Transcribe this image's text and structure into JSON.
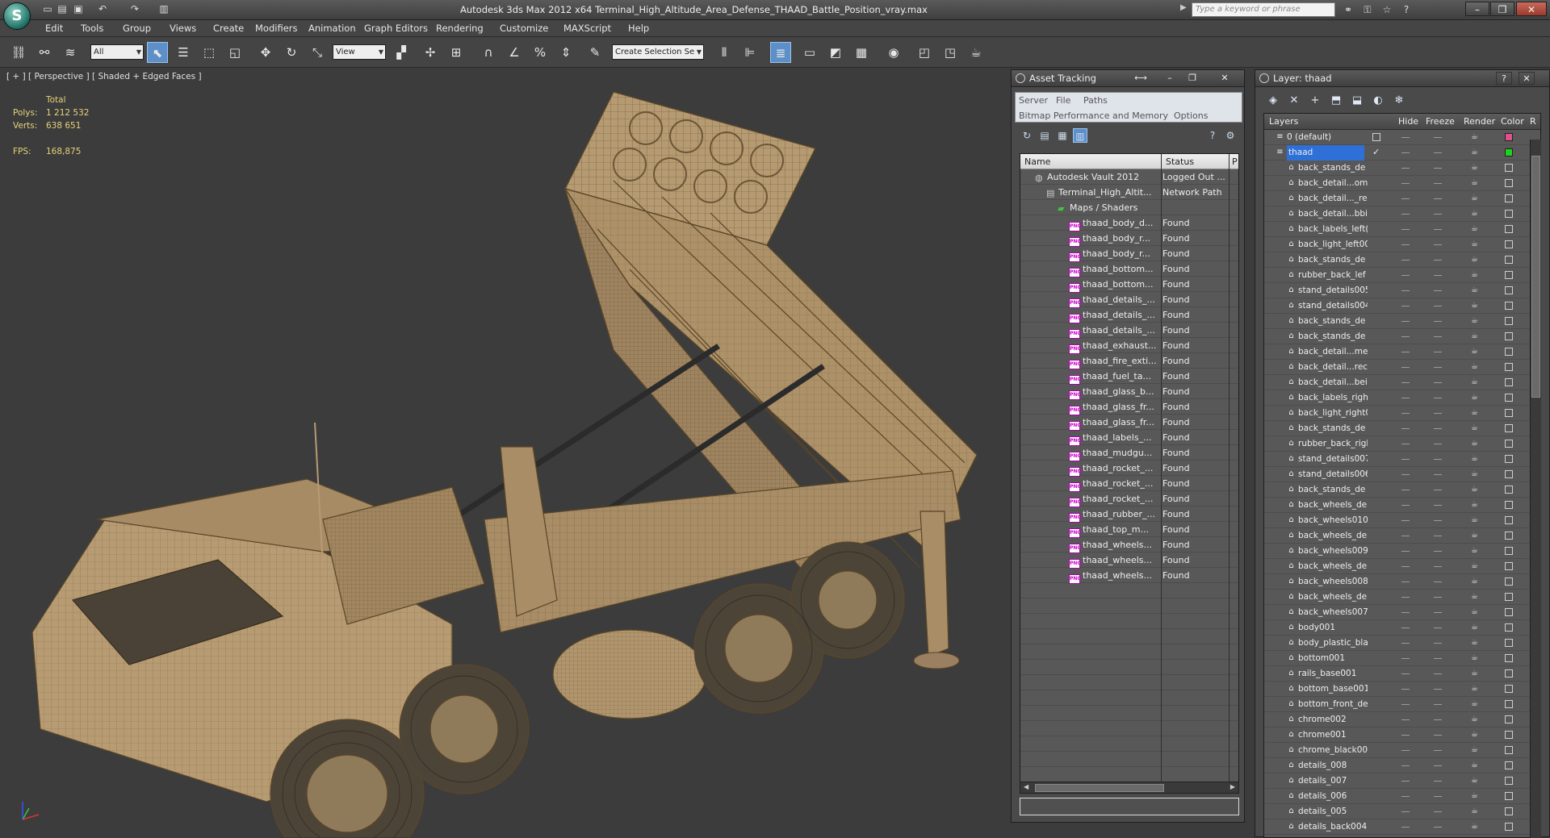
{
  "app": {
    "window_title": "Autodesk 3ds Max  2012 x64     Terminal_High_Altitude_Area_Defense_THAAD_Battle_Position_vray.max",
    "logo_letter": "S",
    "search_placeholder": "Type a keyword or phrase"
  },
  "menu": [
    "Edit",
    "Tools",
    "Group",
    "Views",
    "Create",
    "Modifiers",
    "Animation",
    "Graph Editors",
    "Rendering",
    "Customize",
    "MAXScript",
    "Help"
  ],
  "toolbar": {
    "selection_filter": "All",
    "ref_coord": "View",
    "named_selection": "Create Selection Se"
  },
  "viewport": {
    "label": "[ + ] [ Perspective ] [ Shaded + Edged Faces ]",
    "stats_header": "Total",
    "polys_label": "Polys:",
    "polys_value": "1 212 532",
    "verts_label": "Verts:",
    "verts_value": "638 651",
    "fps_label": "FPS:",
    "fps_value": "168,875"
  },
  "asset_tracking": {
    "title": "Asset Tracking",
    "menu1": [
      "Server",
      "File",
      "Paths"
    ],
    "menu2": [
      "Bitmap Performance and Memory",
      "Options"
    ],
    "col_name": "Name",
    "col_status": "Status",
    "col_extra": "P",
    "rows": [
      {
        "name": "Autodesk Vault 2012",
        "status": "Logged Out ...",
        "kind": "vault",
        "indent": 1
      },
      {
        "name": "Terminal_High_Altit...",
        "status": "Network Path",
        "kind": "file",
        "indent": 2
      },
      {
        "name": "Maps / Shaders",
        "status": "",
        "kind": "folder",
        "indent": 3
      },
      {
        "name": "thaad_body_d...",
        "status": "Found",
        "kind": "png",
        "indent": 4
      },
      {
        "name": "thaad_body_r...",
        "status": "Found",
        "kind": "png",
        "indent": 4
      },
      {
        "name": "thaad_body_r...",
        "status": "Found",
        "kind": "png",
        "indent": 4
      },
      {
        "name": "thaad_bottom...",
        "status": "Found",
        "kind": "png",
        "indent": 4
      },
      {
        "name": "thaad_bottom...",
        "status": "Found",
        "kind": "png",
        "indent": 4
      },
      {
        "name": "thaad_details_...",
        "status": "Found",
        "kind": "png",
        "indent": 4
      },
      {
        "name": "thaad_details_...",
        "status": "Found",
        "kind": "png",
        "indent": 4
      },
      {
        "name": "thaad_details_...",
        "status": "Found",
        "kind": "png",
        "indent": 4
      },
      {
        "name": "thaad_exhaust...",
        "status": "Found",
        "kind": "png",
        "indent": 4
      },
      {
        "name": "thaad_fire_exti...",
        "status": "Found",
        "kind": "png",
        "indent": 4
      },
      {
        "name": "thaad_fuel_ta...",
        "status": "Found",
        "kind": "png",
        "indent": 4
      },
      {
        "name": "thaad_glass_b...",
        "status": "Found",
        "kind": "png",
        "indent": 4
      },
      {
        "name": "thaad_glass_fr...",
        "status": "Found",
        "kind": "png",
        "indent": 4
      },
      {
        "name": "thaad_glass_fr...",
        "status": "Found",
        "kind": "png",
        "indent": 4
      },
      {
        "name": "thaad_labels_...",
        "status": "Found",
        "kind": "png",
        "indent": 4
      },
      {
        "name": "thaad_mudgu...",
        "status": "Found",
        "kind": "png",
        "indent": 4
      },
      {
        "name": "thaad_rocket_...",
        "status": "Found",
        "kind": "png",
        "indent": 4
      },
      {
        "name": "thaad_rocket_...",
        "status": "Found",
        "kind": "png",
        "indent": 4
      },
      {
        "name": "thaad_rocket_...",
        "status": "Found",
        "kind": "png",
        "indent": 4
      },
      {
        "name": "thaad_rubber_...",
        "status": "Found",
        "kind": "png",
        "indent": 4
      },
      {
        "name": "thaad_top_m...",
        "status": "Found",
        "kind": "png",
        "indent": 4
      },
      {
        "name": "thaad_wheels...",
        "status": "Found",
        "kind": "png",
        "indent": 4
      },
      {
        "name": "thaad_wheels...",
        "status": "Found",
        "kind": "png",
        "indent": 4
      },
      {
        "name": "thaad_wheels...",
        "status": "Found",
        "kind": "png",
        "indent": 4
      }
    ]
  },
  "layers": {
    "title": "Layer: thaad",
    "cols": [
      "Layers",
      "Hide",
      "Freeze",
      "Render",
      "Color",
      "R"
    ],
    "top": [
      {
        "name": "0 (default)",
        "color": "#e0508a"
      },
      {
        "name": "thaad",
        "color": "#1ed21e",
        "selected": true
      }
    ],
    "items": [
      "back_stands_de",
      "back_detail...om",
      "back_detail..._re",
      "back_detail...bbi",
      "back_labels_left(",
      "back_light_left00",
      "back_stands_de",
      "rubber_back_lef",
      "stand_details005",
      "stand_details004",
      "back_stands_de",
      "back_stands_de",
      "back_detail...me",
      "back_detail...rec",
      "back_detail...bei",
      "back_labels_righ",
      "back_light_right0",
      "back_stands_de",
      "rubber_back_rigl",
      "stand_details007",
      "stand_details006",
      "back_stands_de",
      "back_wheels_de",
      "back_wheels010",
      "back_wheels_de",
      "back_wheels009",
      "back_wheels_de",
      "back_wheels008",
      "back_wheels_de",
      "back_wheels007",
      "body001",
      "body_plastic_bla",
      "bottom001",
      "rails_base001",
      "bottom_base001",
      "bottom_front_de",
      "chrome002",
      "chrome001",
      "chrome_black00",
      "details_008",
      "details_007",
      "details_006",
      "details_005",
      "details_back004"
    ]
  },
  "colors": {
    "accent": "#5d8fc8",
    "model": "#b79b73",
    "wire": "#5c4a30"
  }
}
